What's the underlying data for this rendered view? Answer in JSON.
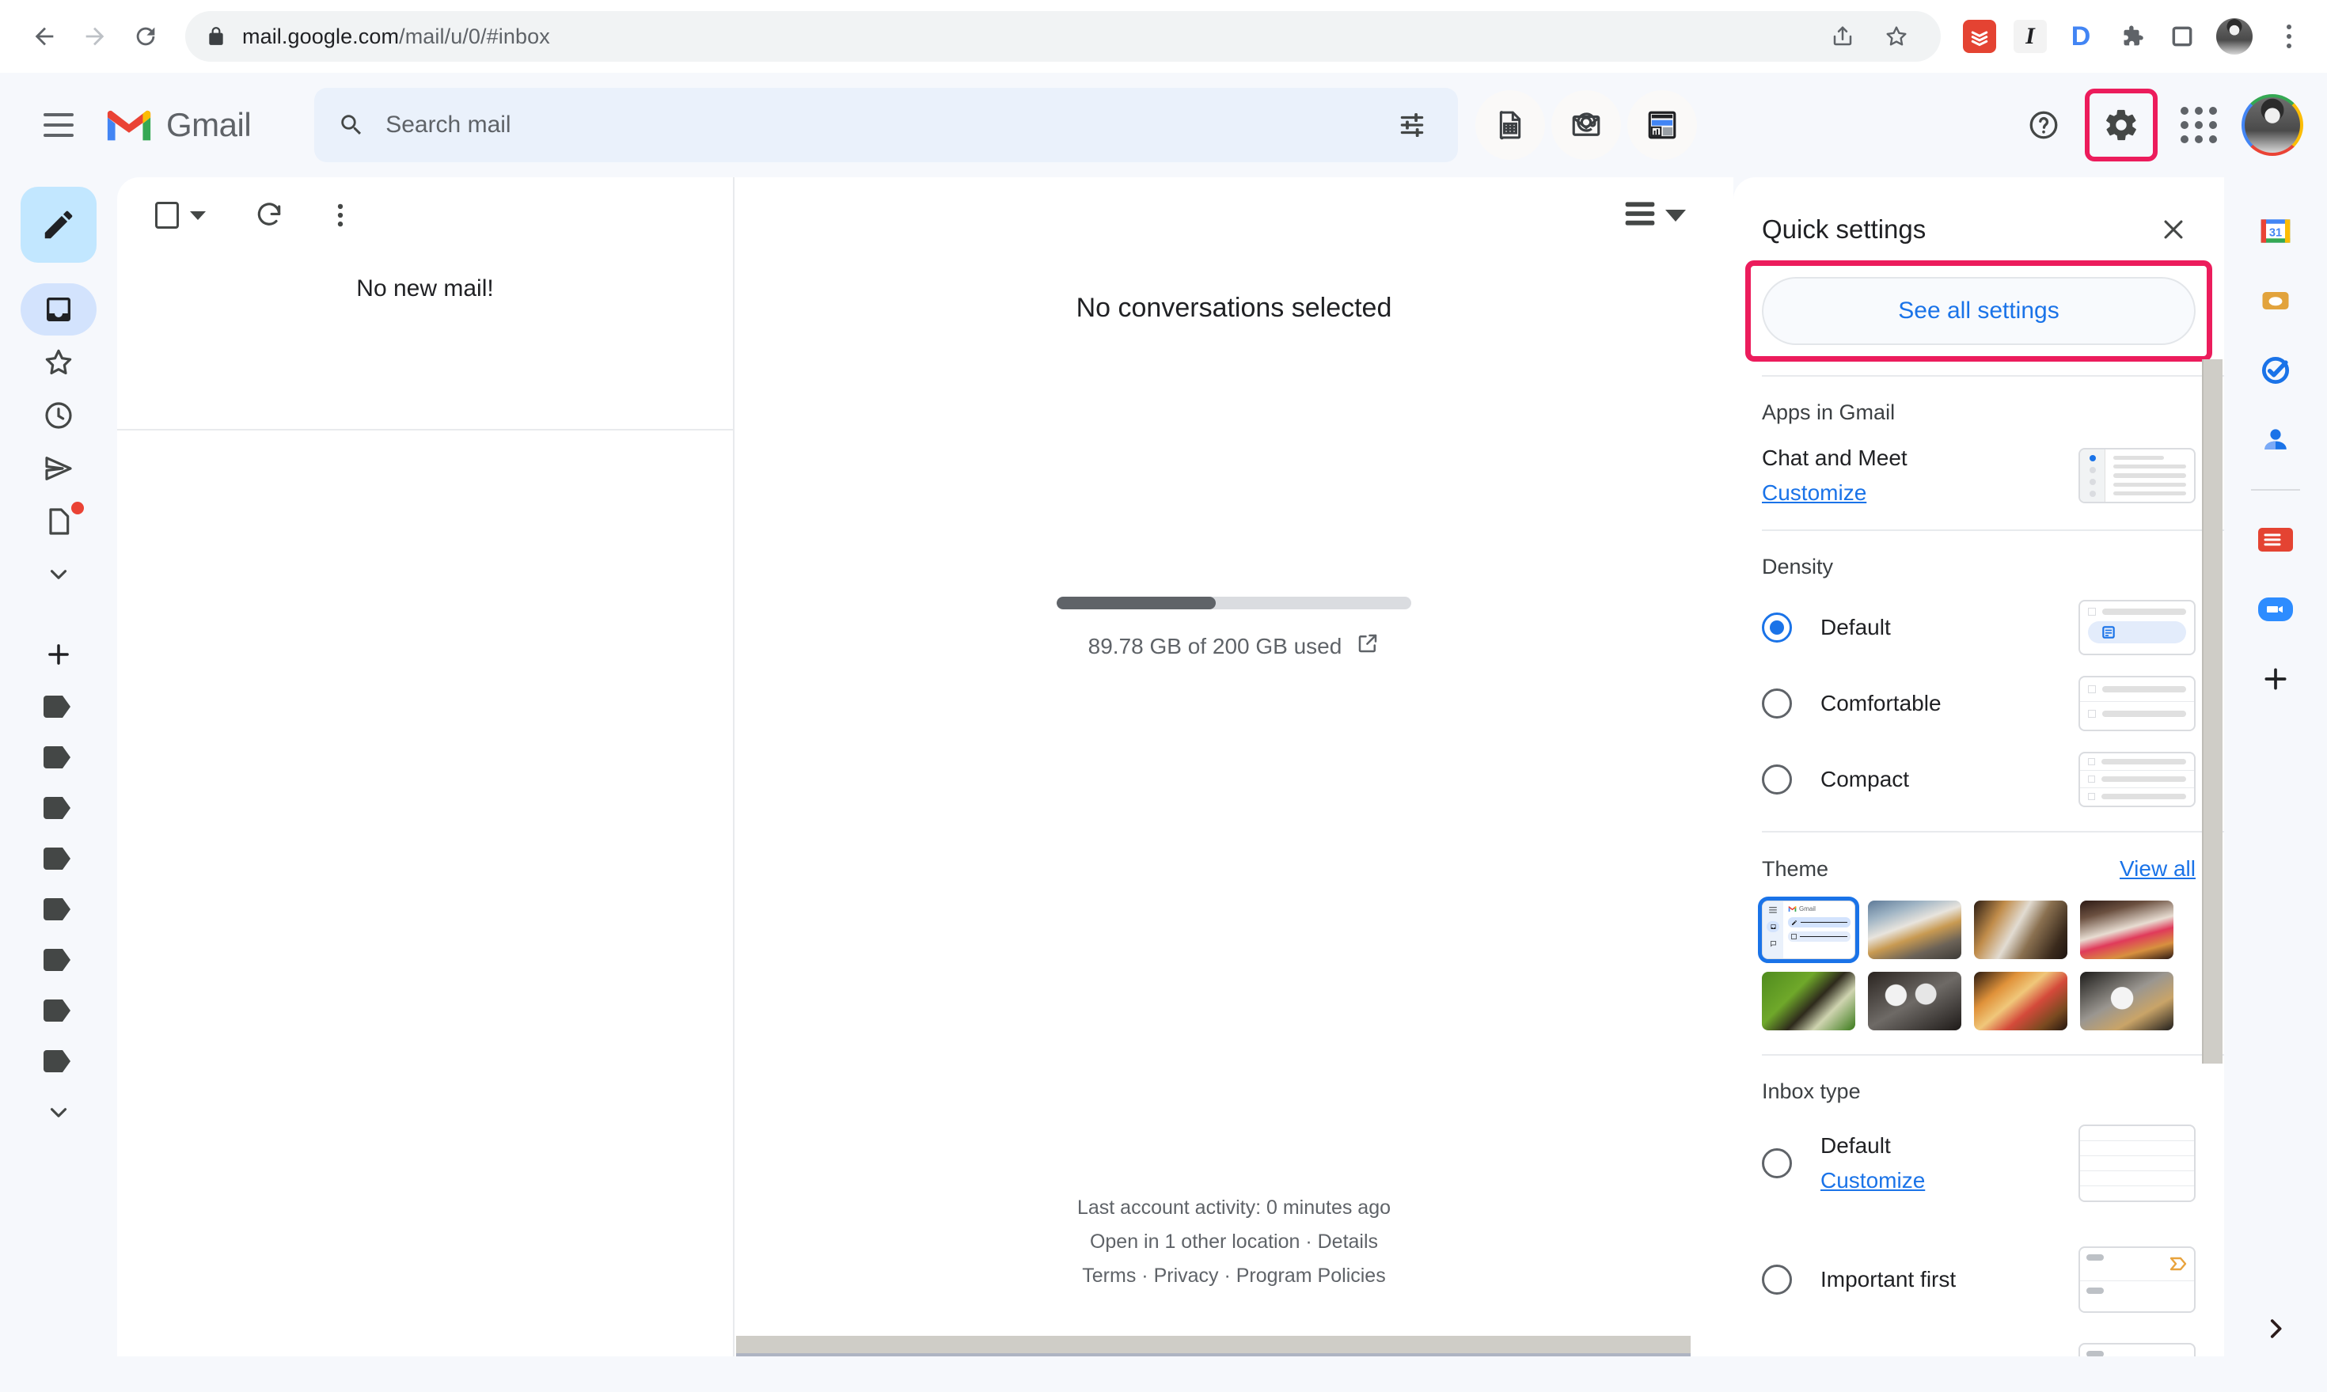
{
  "browser": {
    "url_bold": "mail.google.com",
    "url_rest": "/mail/u/0/#inbox",
    "back_icon": "back-arrow-icon",
    "forward_icon": "forward-arrow-icon",
    "reload_icon": "reload-icon",
    "lock_icon": "lock-icon",
    "share_icon": "share-icon",
    "bookmark_icon": "star-icon",
    "extensions": [
      {
        "name": "todoist-extension",
        "label": ""
      },
      {
        "name": "italic-extension",
        "label": "I"
      },
      {
        "name": "docs-extension",
        "label": "D"
      },
      {
        "name": "puzzle-extension",
        "label": ""
      },
      {
        "name": "sidepanel-extension",
        "label": ""
      }
    ],
    "profile_icon": "chrome-profile-avatar",
    "menu_icon": "chrome-menu-icon"
  },
  "gmail": {
    "menu_icon": "hamburger-menu-icon",
    "brand": "Gmail",
    "search": {
      "placeholder": "Search mail",
      "value": "",
      "icon": "search-icon",
      "options_icon": "search-options-icon"
    },
    "header_apps": [
      {
        "name": "sheets-app-icon"
      },
      {
        "name": "mail-at-icon"
      },
      {
        "name": "dashboard-icon"
      }
    ],
    "help_icon": "help-icon",
    "settings_icon": "gear-icon",
    "apps_icon": "google-apps-grid-icon",
    "account_icon": "google-account-avatar"
  },
  "left_rail": {
    "compose_icon": "compose-pencil-icon",
    "items": [
      {
        "name": "sidebar-item-inbox",
        "icon": "inbox-icon",
        "active": true
      },
      {
        "name": "sidebar-item-starred",
        "icon": "star-icon",
        "active": false
      },
      {
        "name": "sidebar-item-snoozed",
        "icon": "clock-icon",
        "active": false
      },
      {
        "name": "sidebar-item-sent",
        "icon": "send-icon",
        "active": false
      },
      {
        "name": "sidebar-item-drafts",
        "icon": "draft-icon",
        "active": false,
        "badge": true
      }
    ],
    "more_icon": "chevron-down-icon",
    "create_label_icon": "plus-icon",
    "label_count": 8,
    "label_icon": "label-tag-icon",
    "labels_more_icon": "chevron-down-icon"
  },
  "list_pane": {
    "select_all_icon": "select-all-checkbox",
    "select_caret_icon": "chevron-down-icon",
    "refresh_icon": "refresh-icon",
    "more_icon": "more-options-icon",
    "empty_message": "No new mail!"
  },
  "reading_pane": {
    "display_density_icon": "display-density-icon",
    "display_caret_icon": "chevron-down-icon",
    "empty_title": "No conversations selected",
    "storage": {
      "used_gb": 89.78,
      "total_gb": 200,
      "percent": 44.89,
      "text": "89.78 GB of 200 GB used",
      "external_icon": "open-in-new-icon"
    },
    "footer": {
      "activity": "Last account activity: 0 minutes ago",
      "locations": "Open in 1 other location · Details",
      "legal_terms": "Terms",
      "legal_privacy": "Privacy",
      "legal_policies": "Program Policies",
      "sep": " · "
    }
  },
  "quick_settings": {
    "title": "Quick settings",
    "close_icon": "close-icon",
    "see_all_label": "See all settings",
    "highlight_color": "#ec1c5c",
    "apps": {
      "heading": "Apps in Gmail",
      "row_title": "Chat and Meet",
      "customize_label": "Customize"
    },
    "density": {
      "heading": "Density",
      "options": [
        {
          "label": "Default",
          "selected": true
        },
        {
          "label": "Comfortable",
          "selected": false
        },
        {
          "label": "Compact",
          "selected": false
        }
      ]
    },
    "theme": {
      "heading": "Theme",
      "view_all_label": "View all",
      "tiles": [
        {
          "name": "theme-default-light",
          "selected": true,
          "brand": "Gmail"
        },
        {
          "name": "theme-photo-clouds",
          "selected": false
        },
        {
          "name": "theme-photo-architecture",
          "selected": false
        },
        {
          "name": "theme-photo-landscape",
          "selected": false
        },
        {
          "name": "theme-photo-leaf",
          "selected": false
        },
        {
          "name": "theme-photo-bubbles",
          "selected": false
        },
        {
          "name": "theme-photo-autumn",
          "selected": false
        },
        {
          "name": "theme-photo-stones",
          "selected": false
        }
      ]
    },
    "inbox_type": {
      "heading": "Inbox type",
      "options": [
        {
          "label": "Default",
          "selected": false,
          "customize_label": "Customize"
        },
        {
          "label": "Important first",
          "selected": false
        }
      ]
    }
  },
  "right_rail": {
    "items": [
      {
        "name": "google-calendar-icon",
        "label": "31"
      },
      {
        "name": "google-keep-icon"
      },
      {
        "name": "google-tasks-icon"
      },
      {
        "name": "google-contacts-icon"
      }
    ],
    "addons": [
      {
        "name": "todoist-addon-icon"
      },
      {
        "name": "zoom-addon-icon"
      },
      {
        "name": "add-addon-icon"
      }
    ],
    "expand_icon": "chevron-right-icon"
  }
}
